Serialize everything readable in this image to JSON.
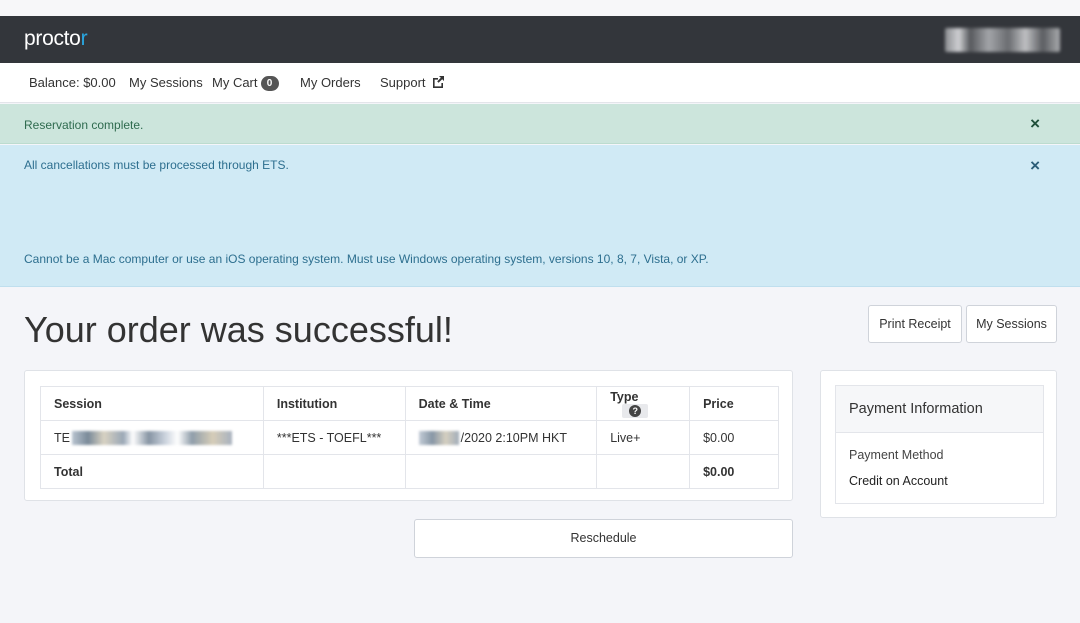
{
  "brand": {
    "logo_main": "procto",
    "logo_accent": "r",
    "accent_color": "#29a7e1"
  },
  "subnav": {
    "balance": "Balance: $0.00",
    "my_sessions": "My Sessions",
    "my_cart": "My Cart",
    "cart_count": "0",
    "my_orders": "My Orders",
    "support": "Support"
  },
  "alerts": {
    "success": {
      "message": "Reservation complete.",
      "close": "×"
    },
    "info": {
      "message_1": "All cancellations must be processed through ETS.",
      "message_2": "Cannot be a Mac computer or use an iOS operating system. Must use Windows operating system, versions 10, 8, 7, Vista, or XP.",
      "close": "×"
    }
  },
  "main": {
    "title": "Your order was successful!",
    "print_receipt": "Print Receipt",
    "my_sessions": "My Sessions",
    "reschedule": "Reschedule"
  },
  "order": {
    "columns": [
      "Session",
      "Institution",
      "Date & Time",
      "Type",
      "Price"
    ],
    "row": {
      "session_prefix": "TE",
      "institution": "***ETS - TOEFL***",
      "datetime_suffix": "/2020 2:10PM HKT",
      "type": "Live+",
      "price": "$0.00"
    },
    "total_label": "Total",
    "total_value": "$0.00"
  },
  "payment": {
    "title": "Payment Information",
    "method_label": "Payment Method",
    "method_value": "Credit on Account"
  }
}
